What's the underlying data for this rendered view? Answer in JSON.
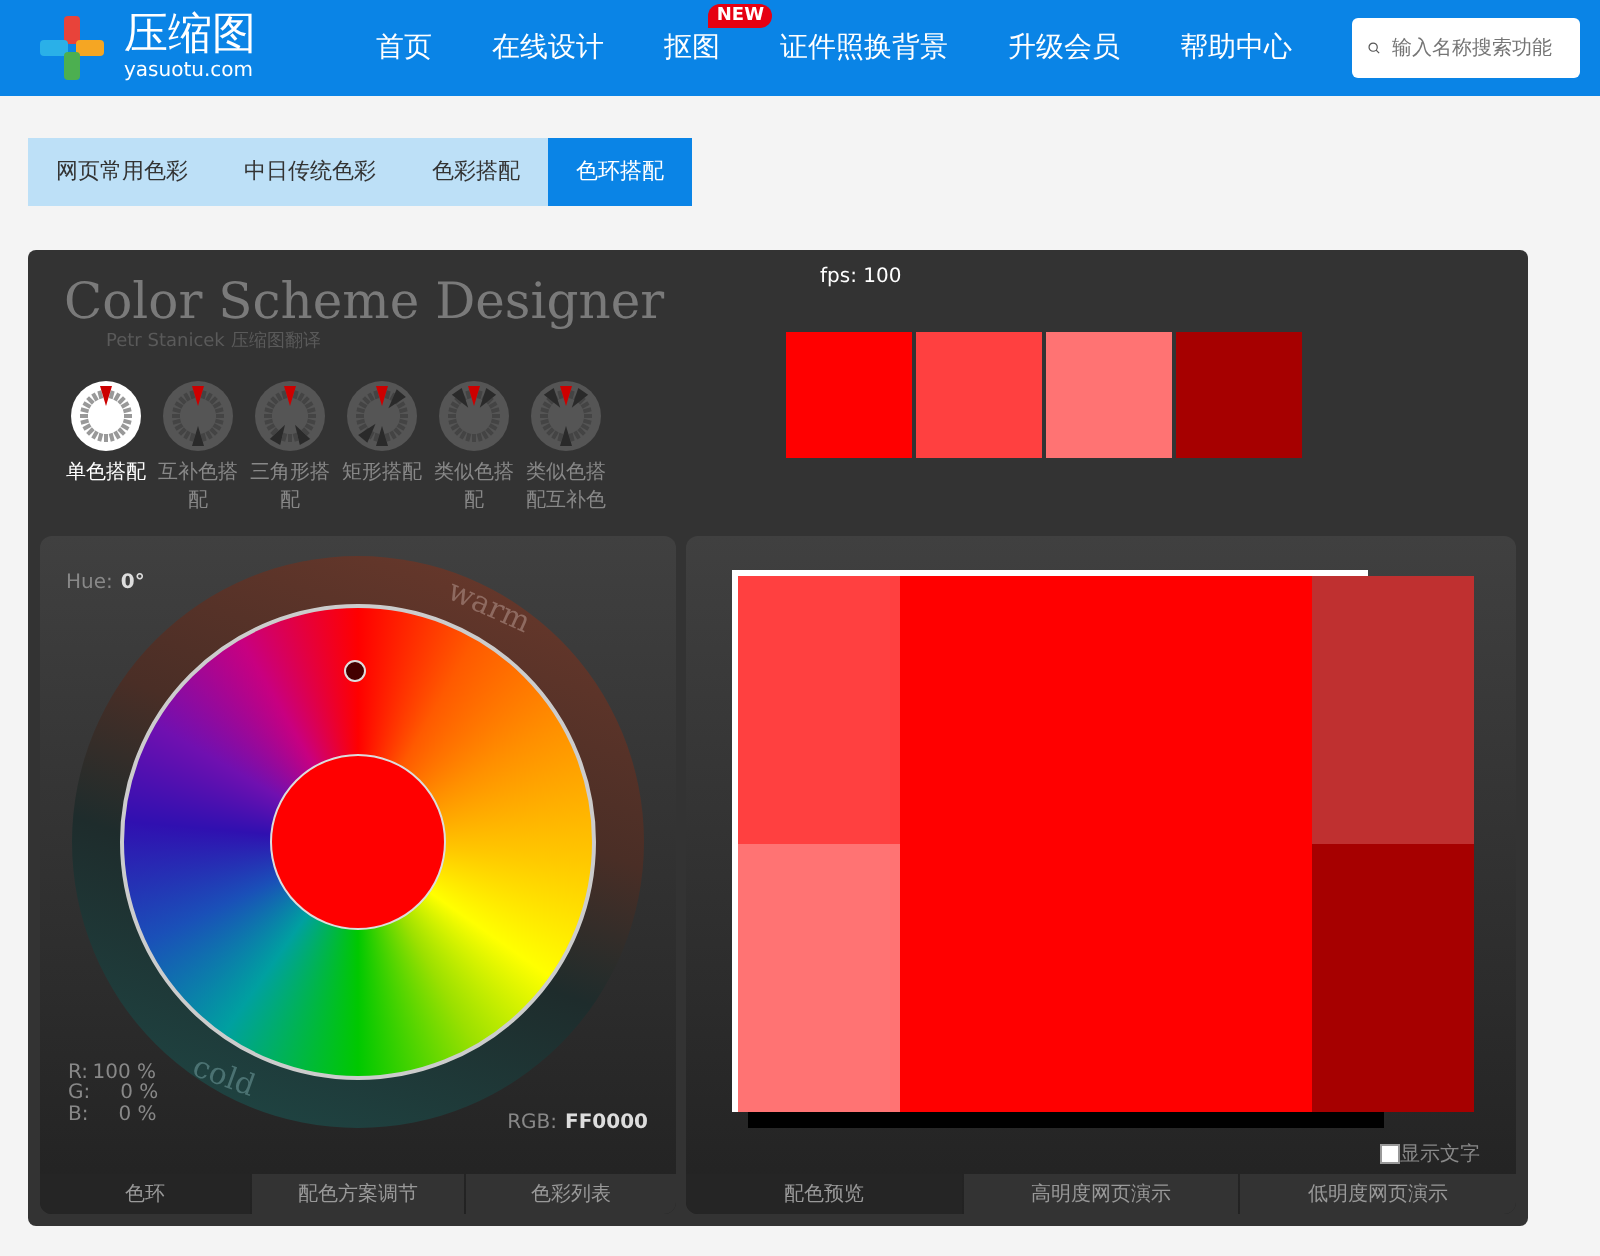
{
  "header": {
    "logo_text": "压缩图",
    "logo_domain": "yasuotu.com",
    "nav": [
      {
        "label": "首页"
      },
      {
        "label": "在线设计"
      },
      {
        "label": "抠图",
        "badge": "NEW"
      },
      {
        "label": "证件照换背景"
      },
      {
        "label": "升级会员"
      },
      {
        "label": "帮助中心"
      }
    ],
    "search": {
      "placeholder": "输入名称搜索功能"
    }
  },
  "tabs": [
    {
      "label": "网页常用色彩",
      "selected": false
    },
    {
      "label": "中日传统色彩",
      "selected": false
    },
    {
      "label": "色彩搭配",
      "selected": false
    },
    {
      "label": "色环搭配",
      "selected": true
    }
  ],
  "designer": {
    "title": "Color Scheme Designer",
    "subtitle": "Petr Stanicek 压缩图翻译",
    "fps": "fps: 100",
    "schemes": [
      {
        "kind": "mono",
        "label": "单色搭配",
        "selected": true
      },
      {
        "kind": "complement",
        "label": "互补色搭配",
        "selected": false
      },
      {
        "kind": "triad",
        "label": "三角形搭配",
        "selected": false
      },
      {
        "kind": "tetrad",
        "label": "矩形搭配",
        "selected": false
      },
      {
        "kind": "analogic",
        "label": "类似色搭配",
        "selected": false
      },
      {
        "kind": "accented",
        "label": "类似色搭配互补色",
        "selected": false
      }
    ],
    "swatches": [
      {
        "color": "#ff0000"
      },
      {
        "color": "#ff4040"
      },
      {
        "color": "#ff7373"
      },
      {
        "color": "#a60000"
      }
    ],
    "wheel": {
      "hue_label": "Hue:",
      "hue": "0°",
      "warm": "warm",
      "cold": "cold",
      "rgb": [
        {
          "label": "R:",
          "value": "100 %"
        },
        {
          "label": "G:",
          "value": "0 %"
        },
        {
          "label": "B:",
          "value": "0 %"
        }
      ],
      "hex_label": "RGB:",
      "hex": "FF0000",
      "tabs": [
        {
          "label": "色环",
          "selected": true
        },
        {
          "label": "配色方案调节",
          "selected": false
        },
        {
          "label": "色彩列表",
          "selected": false
        }
      ]
    },
    "preview": {
      "blocks": [
        {
          "color": "#ff4040"
        },
        {
          "color": "#ff0000"
        },
        {
          "color": "#bf3030"
        },
        {
          "color": "#ff7373"
        },
        {
          "color": "#a60000"
        }
      ],
      "show_text": {
        "label": "显示文字",
        "checked": false
      },
      "tabs": [
        {
          "label": "配色预览",
          "selected": true
        },
        {
          "label": "高明度网页演示",
          "selected": false
        },
        {
          "label": "低明度网页演示",
          "selected": false
        }
      ]
    }
  }
}
